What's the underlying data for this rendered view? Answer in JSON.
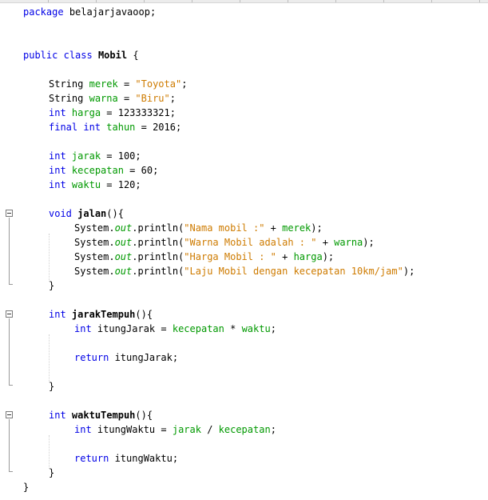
{
  "editor": {
    "package_kw": "package",
    "package_name": "belajarjavaoop;",
    "public_kw": "public",
    "class_kw": "class",
    "class_name": "Mobil",
    "open_brace": "{",
    "close_brace": "}",
    "fields": [
      {
        "type": "String",
        "type_is_kw": false,
        "name": "merek",
        "op": " = ",
        "value": "\"Toyota\"",
        "value_is_string": true
      },
      {
        "type": "String",
        "type_is_kw": false,
        "name": "warna",
        "op": " = ",
        "value": "\"Biru\"",
        "value_is_string": true
      },
      {
        "type": "int",
        "type_is_kw": true,
        "name": "harga",
        "op": " = ",
        "value": "123333321",
        "value_is_string": false
      },
      {
        "type": "final int",
        "type_is_kw": true,
        "name": "tahun",
        "op": " = ",
        "value": "2016",
        "value_is_string": false
      },
      {
        "type": "int",
        "type_is_kw": true,
        "name": "jarak",
        "op": " = ",
        "value": "100",
        "value_is_string": false
      },
      {
        "type": "int",
        "type_is_kw": true,
        "name": "kecepatan",
        "op": " = ",
        "value": "60",
        "value_is_string": false
      },
      {
        "type": "int",
        "type_is_kw": true,
        "name": "waktu",
        "op": " = ",
        "value": "120",
        "value_is_string": false
      }
    ],
    "method_jalan": {
      "ret": "void",
      "name": "jalan",
      "sig_rest": "(){",
      "prints": [
        {
          "prefix": "System.",
          "out": "out",
          "call": ".println(",
          "str": "\"Nama mobil :\"",
          "plus": " + ",
          "var": "merek",
          "end": ");"
        },
        {
          "prefix": "System.",
          "out": "out",
          "call": ".println(",
          "str": "\"Warna Mobil adalah : \"",
          "plus": " + ",
          "var": "warna",
          "end": ");"
        },
        {
          "prefix": "System.",
          "out": "out",
          "call": ".println(",
          "str": "\"Harga Mobil : \"",
          "plus": " + ",
          "var": "harga",
          "end": ");"
        },
        {
          "prefix": "System.",
          "out": "out",
          "call": ".println(",
          "str": "\"Laju Mobil dengan kecepatan 10km/jam\"",
          "plus": "",
          "var": "",
          "end": ");"
        }
      ],
      "close": "}"
    },
    "method_jarak": {
      "ret": "int",
      "name": "jarakTempuh",
      "sig_rest": "(){",
      "decl_type": "int",
      "decl_name": " itungJarak = ",
      "decl_a": "kecepatan",
      "decl_op": " * ",
      "decl_b": "waktu",
      "decl_end": ";",
      "return_kw": "return",
      "return_val": " itungJarak;",
      "close": "}"
    },
    "method_waktu": {
      "ret": "int",
      "name": "waktuTempuh",
      "sig_rest": "(){",
      "decl_type": "int",
      "decl_name": " itungWaktu = ",
      "decl_a": "jarak",
      "decl_op": " / ",
      "decl_b": "kecepatan",
      "decl_end": ";",
      "return_kw": "return",
      "return_val": " itungWaktu;",
      "close": "}"
    }
  }
}
